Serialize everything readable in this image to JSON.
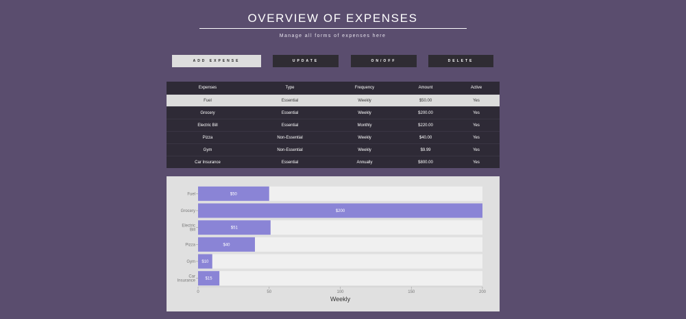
{
  "header": {
    "title": "OVERVIEW OF EXPENSES",
    "subtitle": "Manage all forms of expenses here"
  },
  "toolbar": {
    "add_label": "ADD EXPENSE",
    "update_label": "UPDATE",
    "toggle_label": "ON/OFF",
    "delete_label": "DELETE"
  },
  "table": {
    "headers": [
      "Expenses",
      "Type",
      "Frequency",
      "Amount",
      "Active"
    ],
    "rows": [
      [
        "Fuel",
        "Essential",
        "Weekly",
        "$50.00",
        "Yes"
      ],
      [
        "Grocery",
        "Essential",
        "Weekly",
        "$200.00",
        "Yes"
      ],
      [
        "Electric Bill",
        "Essential",
        "Monthly",
        "$220.00",
        "Yes"
      ],
      [
        "Pizza",
        "Non-Essential",
        "Weekly",
        "$40.00",
        "Yes"
      ],
      [
        "Gym",
        "Non-Essential",
        "Weekly",
        "$9.99",
        "Yes"
      ],
      [
        "Car Insurance",
        "Essential",
        "Annually",
        "$800.00",
        "Yes"
      ]
    ],
    "selected_row": 0
  },
  "chart_data": {
    "type": "bar",
    "orientation": "horizontal",
    "categories": [
      "Fuel",
      "Grocery",
      "Electric Bill",
      "Pizza",
      "Gym",
      "Car Insurance"
    ],
    "category_lines": [
      [
        "Fuel"
      ],
      [
        "Grocery"
      ],
      [
        "Electric",
        "Bill"
      ],
      [
        "Pizza"
      ],
      [
        "Gym"
      ],
      [
        "Car",
        "Insurance"
      ]
    ],
    "values": [
      50,
      200,
      51,
      40,
      10,
      15
    ],
    "data_labels": [
      "$50",
      "$200",
      "$51",
      "$40",
      "$10",
      "$15"
    ],
    "xlabel": "Weekly",
    "xlim": [
      0,
      200
    ],
    "xticks": [
      0,
      50,
      100,
      150,
      200
    ],
    "grid": false,
    "colors": {
      "bar": "#8a84d6",
      "track": "#f0f0f0"
    }
  },
  "colors": {
    "background": "#5a4d6e",
    "table_bg": "#2e2a36",
    "selected_row": "#dcdcdc"
  }
}
